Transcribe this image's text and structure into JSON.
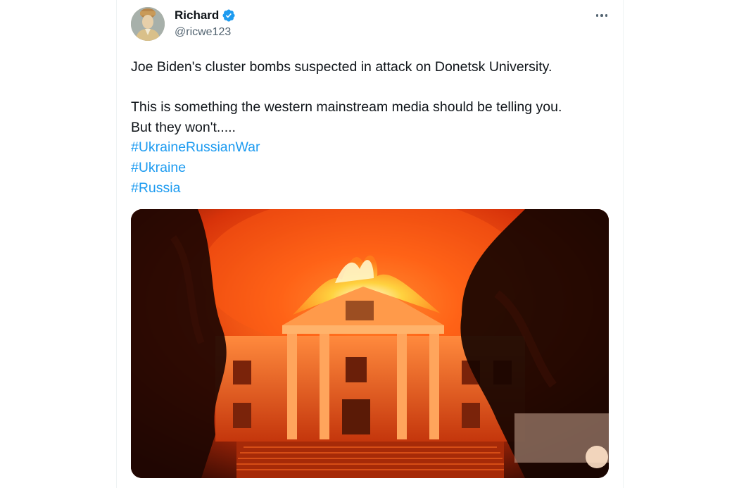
{
  "tweet": {
    "author": {
      "display_name": "Richard",
      "handle": "@ricwe123",
      "verified_icon": "verified-badge-icon",
      "avatar": "portrait-avatar"
    },
    "more_icon": "more-horizontal-icon",
    "text": {
      "line1": "Joe Biden's cluster bombs suspected in attack on Donetsk University.",
      "line2": "This is something the western mainstream media should be telling you.",
      "line3": "But they won't.....",
      "hashtags": [
        "#UkraineRussianWar",
        "#Ukraine",
        "#Russia"
      ]
    },
    "media": {
      "kind": "photo",
      "subject": "burning-building-photo"
    }
  },
  "colors": {
    "text": "#0f1419",
    "secondary": "#536471",
    "link": "#1d9bf0",
    "verified": "#1d9bf0"
  }
}
